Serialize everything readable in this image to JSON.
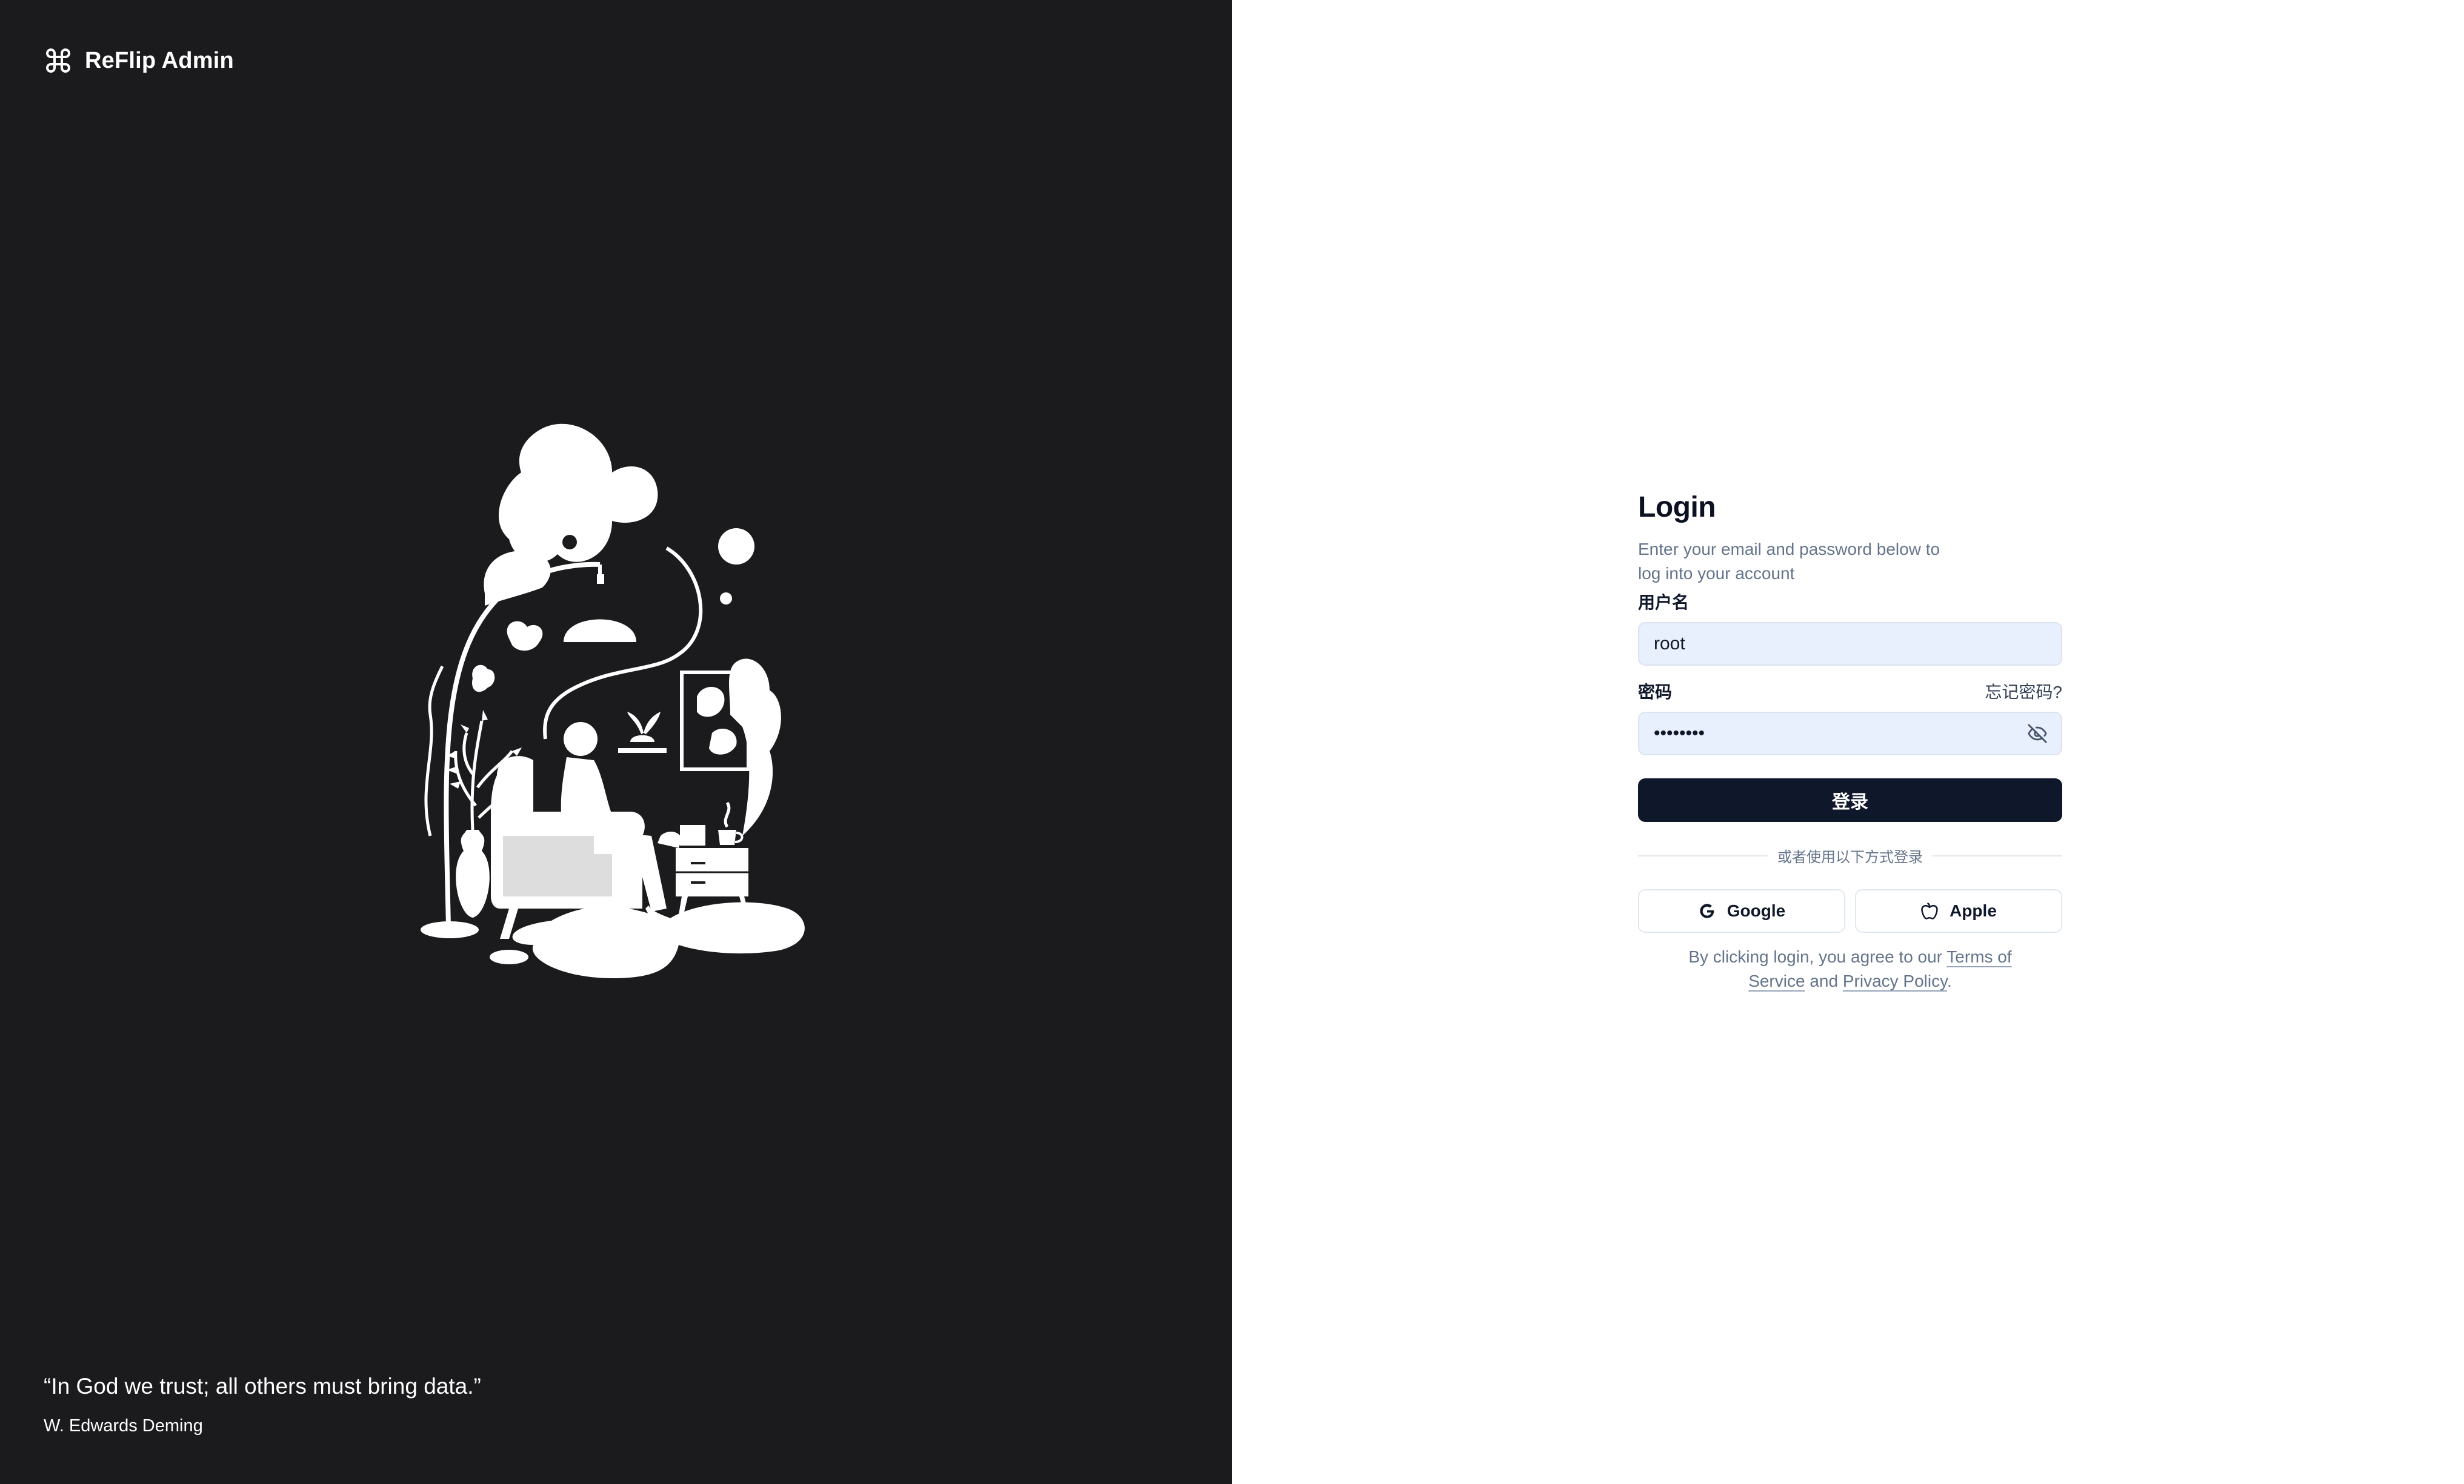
{
  "brand": {
    "name": "ReFlip Admin",
    "icon": "command-icon"
  },
  "quote": {
    "text": "“In God we trust; all others must bring data.”",
    "author": "W. Edwards Deming"
  },
  "illustration": {
    "icon": "person-in-armchair-illustration"
  },
  "login": {
    "title": "Login",
    "subtitle": "Enter your email and password below to log into your account",
    "username_label": "用户名",
    "username_value": "root",
    "password_label": "密码",
    "forgot_label": "忘记密码?",
    "password_value": "••••••••",
    "password_toggle_icon": "eye-off-icon",
    "submit_label": "登录",
    "divider_text": "或者使用以下方式登录",
    "social": [
      {
        "label": "Google",
        "icon": "google-icon"
      },
      {
        "label": "Apple",
        "icon": "apple-icon"
      }
    ],
    "terms": {
      "prefix": "By clicking login, you agree to our ",
      "terms_link": "Terms of Service",
      "middle": " and ",
      "privacy_link": "Privacy Policy",
      "suffix": "."
    }
  },
  "colors": {
    "left_panel_bg": "#1b1b1d",
    "primary_button": "#0f172a",
    "input_bg": "#e8f0fe",
    "muted_text": "#64748b"
  }
}
